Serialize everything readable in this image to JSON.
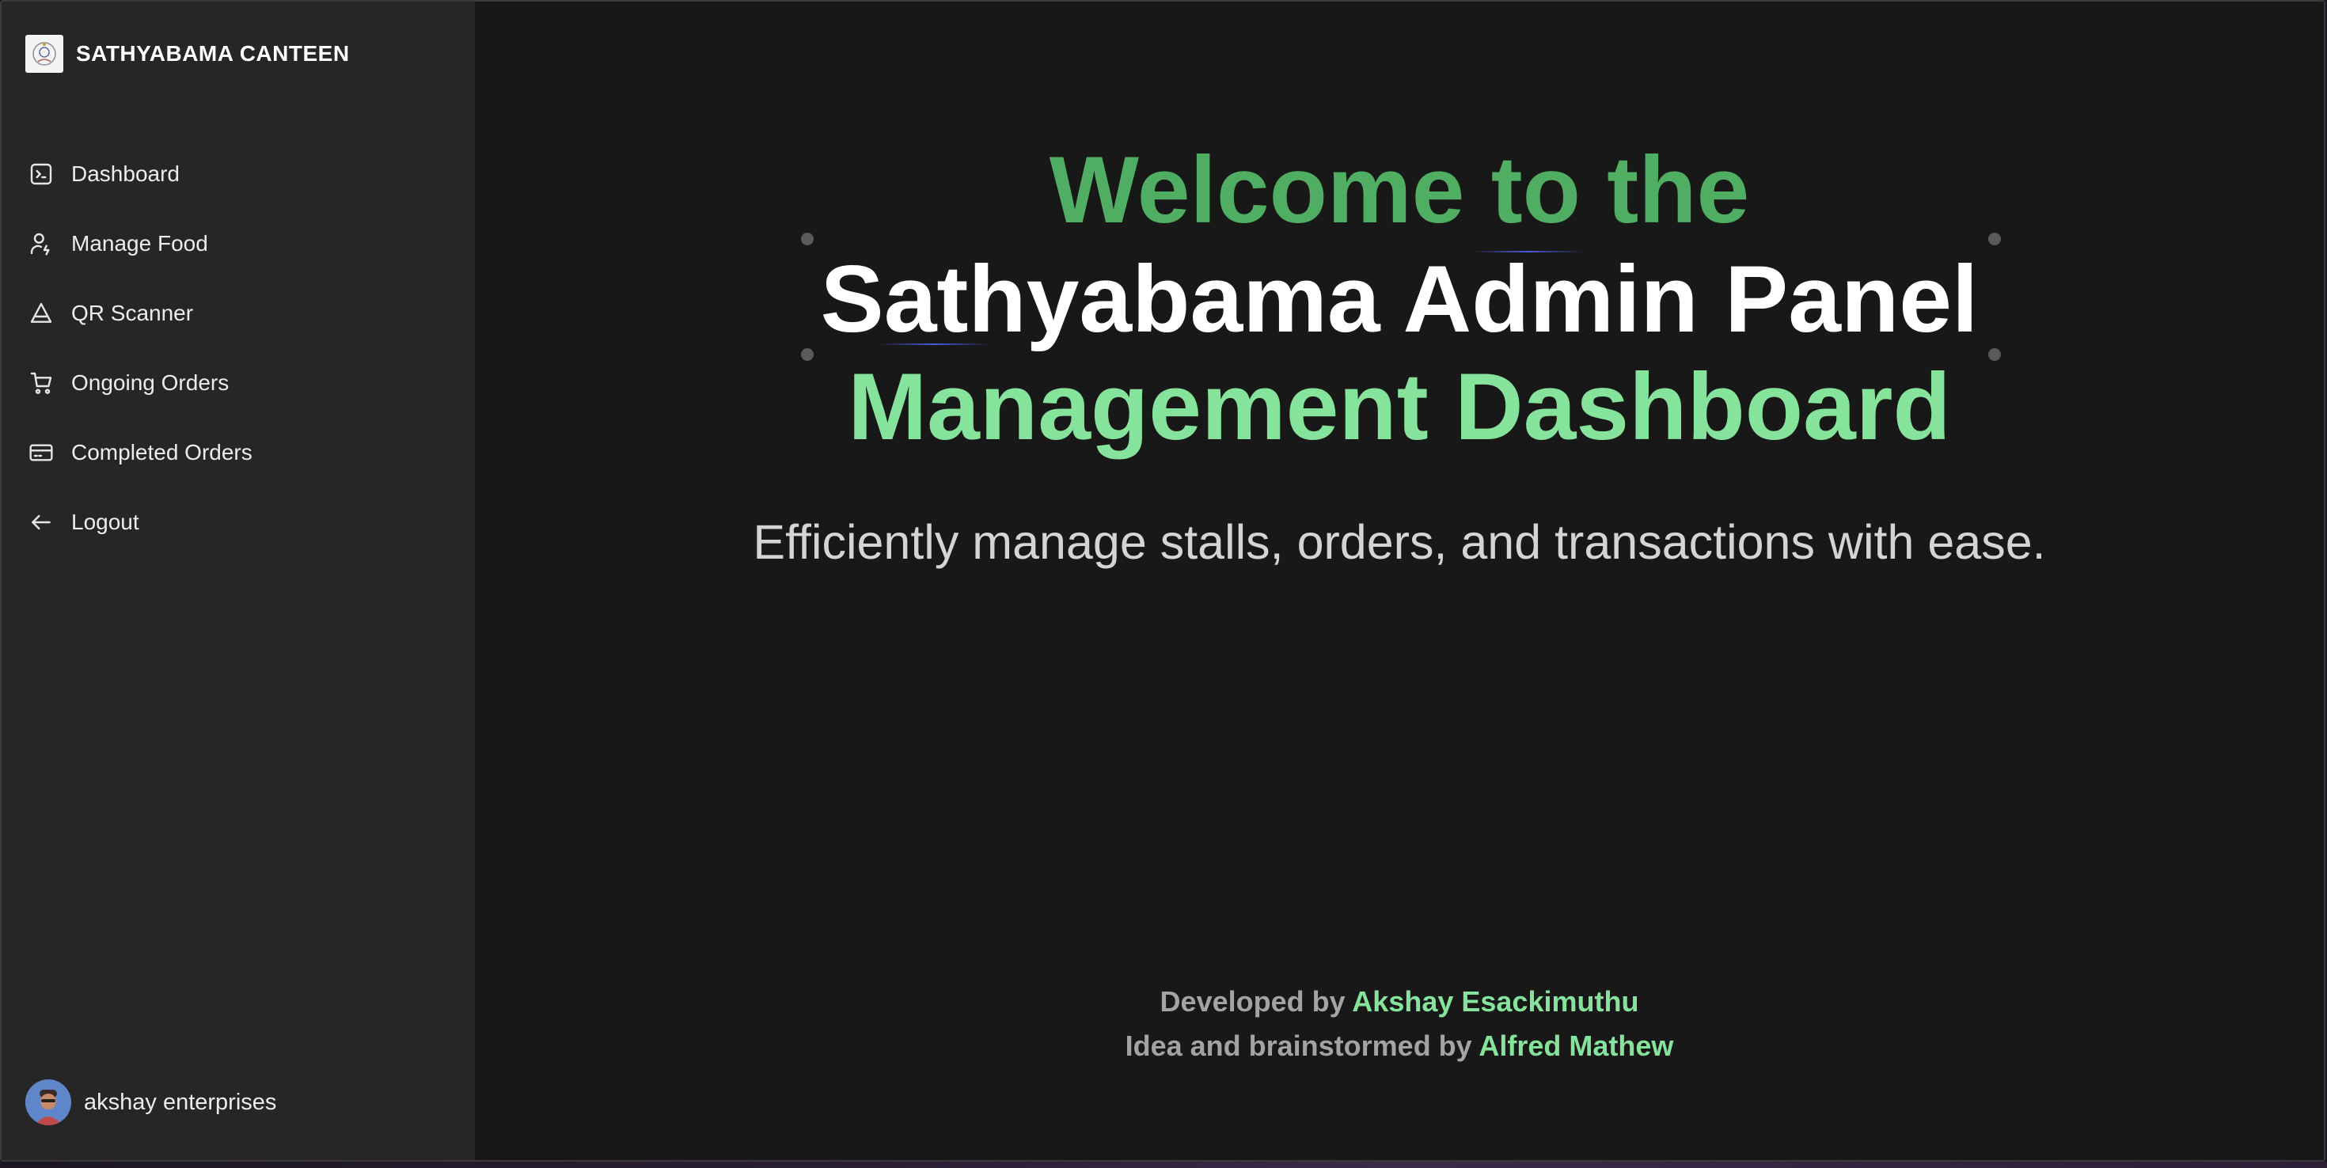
{
  "sidebar": {
    "brand": {
      "name": "SATHYABAMA CANTEEN",
      "logo_icon": "canteen-logo-icon"
    },
    "items": [
      {
        "label": "Dashboard",
        "icon": "terminal-square-icon"
      },
      {
        "label": "Manage Food",
        "icon": "user-cog-icon"
      },
      {
        "label": "QR Scanner",
        "icon": "triangle-scan-icon"
      },
      {
        "label": "Ongoing Orders",
        "icon": "cart-icon"
      },
      {
        "label": "Completed Orders",
        "icon": "credit-card-icon"
      },
      {
        "label": "Logout",
        "icon": "arrow-left-icon"
      }
    ],
    "user": {
      "name": "akshay enterprises",
      "avatar_icon": "user-avatar"
    }
  },
  "main": {
    "hero": {
      "line1": "Welcome to the",
      "line2": "Sathyabama Admin Panel",
      "line3": "Management Dashboard"
    },
    "subtitle": "Efficiently manage stalls, orders, and transactions with ease.",
    "credits": {
      "developed_prefix": "Developed by",
      "developer": "Akshay Esackimuthu",
      "idea_prefix": "Idea and brainstormed by",
      "ideator": "Alfred Mathew"
    }
  },
  "colors": {
    "sidebar_bg": "#262626",
    "main_bg": "#181818",
    "accent_dark_green": "#4fae61",
    "accent_light_green": "#86e39b",
    "text_white": "#ffffff",
    "text_muted": "#a3a3a3"
  }
}
